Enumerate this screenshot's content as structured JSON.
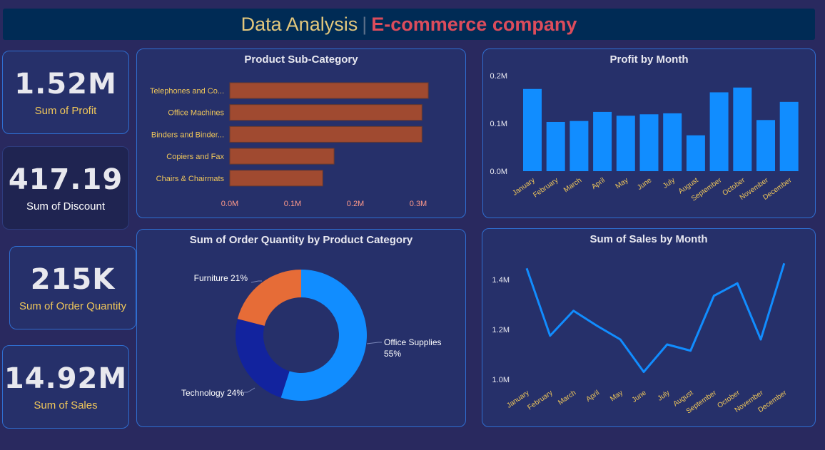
{
  "header": {
    "title_part1": "Data Analysis",
    "separator": "|",
    "title_part2": "E-commerce company"
  },
  "kpis": [
    {
      "value": "1.52M",
      "label": "Sum of Profit"
    },
    {
      "value": "417.19",
      "label": "Sum of Discount"
    },
    {
      "value": "215K",
      "label": "Sum of Order Quantity"
    },
    {
      "value": "14.92M",
      "label": "Sum of Sales"
    }
  ],
  "colors": {
    "bar_orange": "#a04a30",
    "blue": "#118dff",
    "navy": "#12239e",
    "orange": "#e66c37",
    "label_yellow": "#f0c75a",
    "tick_pink": "#ff9a8a"
  },
  "chart_data": [
    {
      "type": "bar",
      "orientation": "horizontal",
      "title": "Product Sub-Category",
      "categories": [
        "Telephones and Co...",
        "Office Machines",
        "Binders and Binder...",
        "Copiers and Fax",
        "Chairs & Chairmats"
      ],
      "values": [
        0.316,
        0.306,
        0.306,
        0.166,
        0.148
      ],
      "unit": "M",
      "xticks": [
        "0.0M",
        "0.1M",
        "0.2M",
        "0.3M"
      ],
      "xlim": [
        0,
        0.3
      ]
    },
    {
      "type": "bar",
      "title": "Profit by Month",
      "categories": [
        "January",
        "February",
        "March",
        "April",
        "May",
        "June",
        "July",
        "August",
        "September",
        "October",
        "November",
        "December"
      ],
      "values": [
        0.172,
        0.103,
        0.105,
        0.124,
        0.116,
        0.119,
        0.121,
        0.075,
        0.165,
        0.175,
        0.107,
        0.145
      ],
      "unit": "M",
      "yticks": [
        "0.0M",
        "0.1M",
        "0.2M"
      ],
      "ylim": [
        0,
        0.2
      ]
    },
    {
      "type": "pie",
      "title": "Sum of Order Quantity by Product Category",
      "slices": [
        {
          "label": "Office Supplies",
          "pct_label": "55%",
          "value": 55
        },
        {
          "label": "Technology",
          "pct_label": "24%",
          "value": 24
        },
        {
          "label": "Furniture",
          "pct_label": "21%",
          "value": 21
        }
      ],
      "labels_text": [
        "Office Supplies",
        "55%",
        "Technology 24%",
        "Furniture 21%"
      ]
    },
    {
      "type": "line",
      "title": "Sum of Sales by Month",
      "categories": [
        "January",
        "February",
        "March",
        "April",
        "May",
        "June",
        "July",
        "August",
        "September",
        "October",
        "November",
        "December"
      ],
      "values": [
        1.445,
        1.175,
        1.275,
        1.215,
        1.16,
        1.03,
        1.14,
        1.115,
        1.335,
        1.385,
        1.16,
        1.465
      ],
      "unit": "M",
      "yticks": [
        "1.0M",
        "1.2M",
        "1.4M"
      ],
      "ylim": [
        1.0,
        1.4
      ]
    }
  ]
}
